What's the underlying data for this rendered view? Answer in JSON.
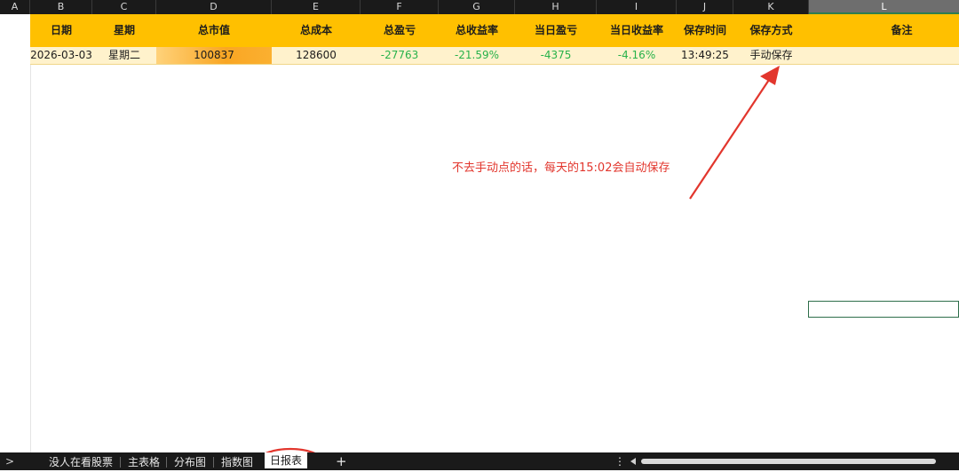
{
  "columns": [
    "A",
    "B",
    "C",
    "D",
    "E",
    "F",
    "G",
    "H",
    "I",
    "J",
    "K",
    "L"
  ],
  "table": {
    "headers": [
      "日期",
      "星期",
      "总市值",
      "总成本",
      "总盈亏",
      "总收益率",
      "当日盈亏",
      "当日收益率",
      "保存时间",
      "保存方式",
      "备注"
    ],
    "rows": [
      {
        "date": "2026-03-03",
        "weekday": "星期二",
        "market_value": "100837",
        "total_cost": "128600",
        "total_pnl": "-27763",
        "total_return": "-21.59%",
        "daily_pnl": "-4375",
        "daily_return": "-4.16%",
        "save_time": "13:49:25",
        "save_method": "手动保存",
        "note": ""
      }
    ]
  },
  "annotation": {
    "text": "不去手动点的话，每天的15:02会自动保存"
  },
  "sheet_tabs": {
    "nav_arrow": ">",
    "tabs": [
      "没人在看股票",
      "主表格",
      "分布图",
      "指数图",
      "日报表"
    ],
    "active_index": 4,
    "add_label": "+",
    "more_label": "⋮"
  },
  "colors": {
    "header_bg": "#ffc000",
    "data_row_bg": "#fff2cc",
    "positive_negative_text": "#27b24a",
    "annotation_red": "#e2362d",
    "highlight_cell": "#f9a623"
  }
}
